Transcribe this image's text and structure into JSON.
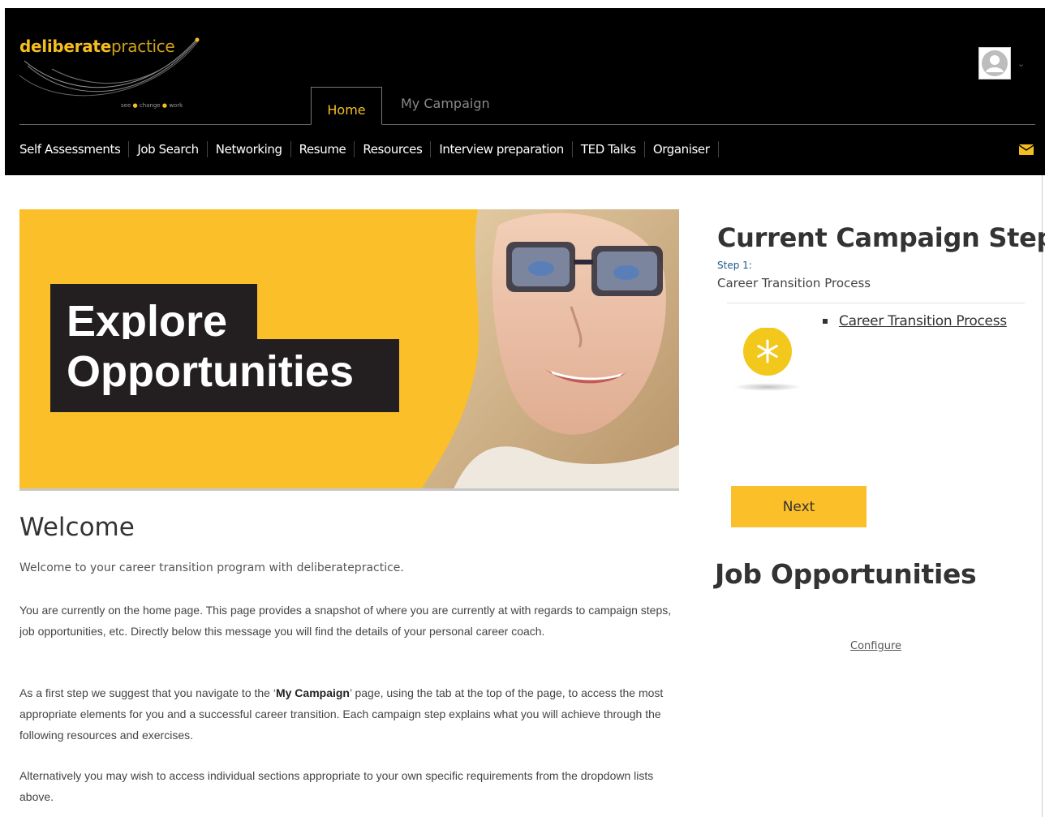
{
  "logo": {
    "brand_bold": "deliberate",
    "brand_light": "practice",
    "tag_see": "see",
    "tag_change": "change",
    "tag_work": "work"
  },
  "tabs": [
    {
      "label": "Home",
      "active": true
    },
    {
      "label": "My Campaign",
      "active": false
    }
  ],
  "nav": [
    "Self Assessments",
    "Job Search",
    "Networking",
    "Resume",
    "Resources",
    "Interview preparation",
    "TED Talks",
    "Organiser"
  ],
  "icons": {
    "user": "user-avatar-icon",
    "caret": "chevron-down-icon",
    "mail": "envelope-icon",
    "step": "asterisk-icon"
  },
  "colors": {
    "accent": "#fbbf2a",
    "header_bg": "#000000",
    "step_label": "#1a5a8a"
  },
  "banner": {
    "line1": "Explore",
    "line2": "Opportunities"
  },
  "welcome": {
    "title": "Welcome",
    "intro": "Welcome to your career transition program with deliberatepractice.",
    "p1": "You are currently on the home page. This page provides a snapshot of where you are currently at with regards to campaign steps, job opportunities, etc. Directly below this message you will find the details of your personal career coach.",
    "p2_before": "As a first step we suggest that you navigate to the ‘",
    "p2_bold": "My Campaign",
    "p2_after": "’ page, using the tab at the top of the page, to access the most appropriate elements for you and a successful career transition. Each campaign step explains what you will achieve through the following resources and exercises.",
    "p3": "Alternatively you may wish to access individual sections appropriate to your own specific requirements from the dropdown lists above."
  },
  "campaign": {
    "title": "Current Campaign Step",
    "step_label": "Step 1:",
    "step_name": "Career Transition Process",
    "link": "Career Transition Process",
    "next_label": "Next"
  },
  "jobs": {
    "title": "Job Opportunities",
    "configure_label": "Configure"
  }
}
